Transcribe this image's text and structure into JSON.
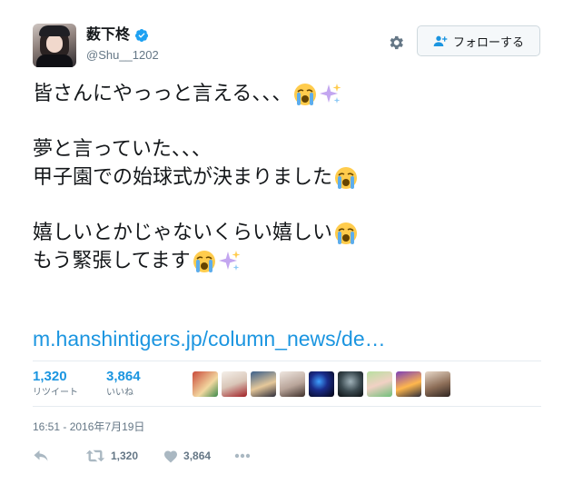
{
  "user": {
    "display_name": "薮下柊",
    "screen_name": "@Shu__1202",
    "verified": true
  },
  "follow_button": {
    "label": "フォローする"
  },
  "tweet": {
    "lines": [
      "皆さんにやっっと言える、、、",
      "夢と言っていた、、、",
      "甲子園での始球式が決まりました",
      "嬉しいとかじゃないくらい嬉しい",
      "もう緊張してます"
    ],
    "link": "m.hanshintigers.jp/column_news/de…"
  },
  "stats": {
    "retweets": {
      "count": "1,320",
      "label": "リツイート"
    },
    "likes": {
      "count": "3,864",
      "label": "いいね"
    }
  },
  "likers_count_shown": 9,
  "timestamp": "16:51 - 2016年7月19日",
  "actions": {
    "retweet_count": "1,320",
    "like_count": "3,864"
  },
  "colors": {
    "link": "#1b95e0",
    "verified": "#1da1f2",
    "secondary_text": "#657786",
    "like_heart": "#aab8c2"
  },
  "icons": {
    "verified": "verified-badge-icon",
    "gear": "gear-icon",
    "follow": "person-add-icon",
    "reply": "reply-icon",
    "retweet": "retweet-icon",
    "like": "heart-icon",
    "more": "more-dots-icon",
    "emoji_cry": "loudly-crying-face-emoji",
    "emoji_sparkles": "sparkles-emoji"
  }
}
